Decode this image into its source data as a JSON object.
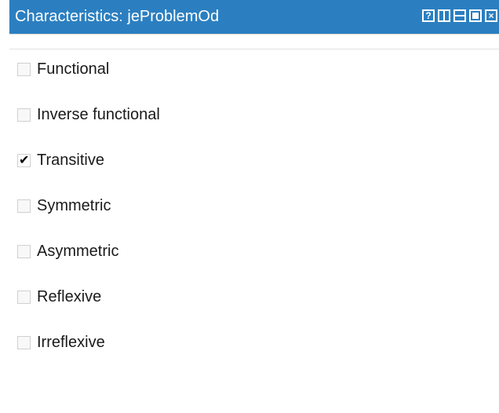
{
  "window": {
    "title": "Characteristics: jeProblemOd",
    "buttons": [
      {
        "name": "help",
        "glyph": "?"
      },
      {
        "name": "split-vertical",
        "glyph": ""
      },
      {
        "name": "split-horizontal",
        "glyph": ""
      },
      {
        "name": "maximize",
        "glyph": ""
      },
      {
        "name": "close",
        "glyph": "×"
      }
    ]
  },
  "characteristics": [
    {
      "label": "Functional",
      "checked": false
    },
    {
      "label": "Inverse functional",
      "checked": false
    },
    {
      "label": "Transitive",
      "checked": true
    },
    {
      "label": "Symmetric",
      "checked": false
    },
    {
      "label": "Asymmetric",
      "checked": false
    },
    {
      "label": "Reflexive",
      "checked": false
    },
    {
      "label": "Irreflexive",
      "checked": false
    }
  ],
  "colors": {
    "titlebar": "#2b7fc0",
    "title_text": "#ffffff",
    "checkbox_border": "#d0d0d0"
  },
  "icons": {
    "check": "✔"
  }
}
